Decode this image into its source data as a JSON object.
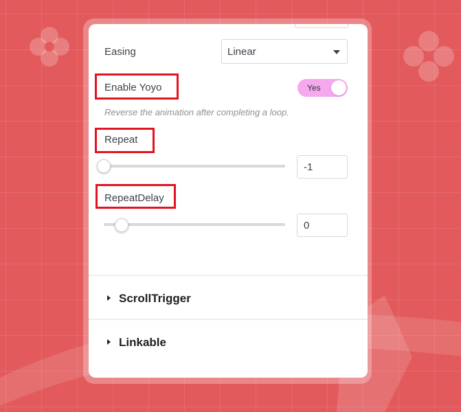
{
  "panel": {
    "easing": {
      "label": "Easing",
      "value": "Linear"
    },
    "yoyo": {
      "label": "Enable Yoyo",
      "toggle_label": "Yes",
      "enabled": true,
      "description": "Reverse the animation after completing a loop."
    },
    "repeat": {
      "label": "Repeat",
      "value": "-1",
      "slider_fraction": 0.0
    },
    "repeat_delay": {
      "label": "RepeatDelay",
      "value": "0",
      "slider_fraction": 0.1
    },
    "sections": [
      {
        "title": "ScrollTrigger"
      },
      {
        "title": "Linkable"
      }
    ]
  },
  "colors": {
    "background": "#e25a5c",
    "highlight": "#e3121f",
    "toggle_on": "#f5a8ee"
  }
}
